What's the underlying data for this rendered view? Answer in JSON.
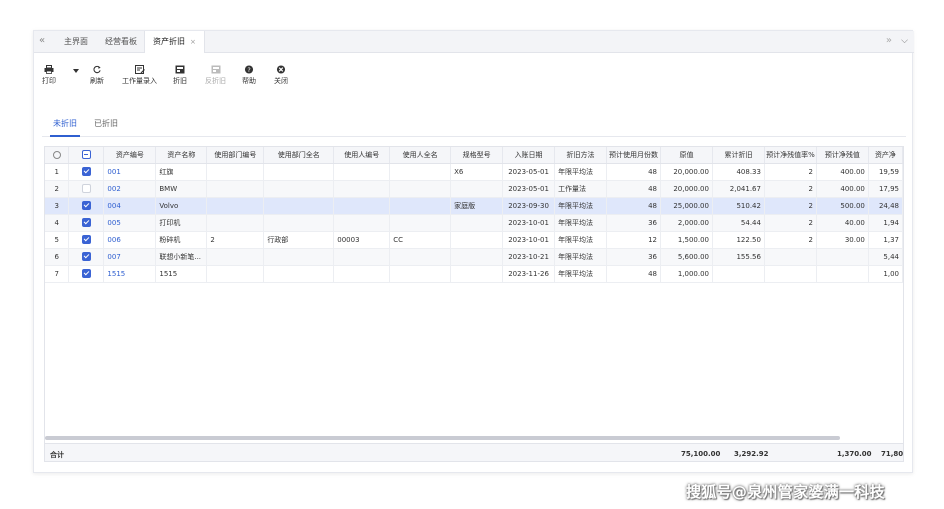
{
  "tabbar": {
    "tabs": [
      {
        "label": "主界面"
      },
      {
        "label": "经营看板"
      },
      {
        "label": "资产折旧",
        "close": "×"
      }
    ]
  },
  "toolbar": {
    "print": "打印",
    "refresh": "刷新",
    "workload": "工作量录入",
    "depreciate": "折旧",
    "reverse": "反折旧",
    "help": "帮助",
    "close": "关闭"
  },
  "subtabs": [
    "未折旧",
    "已折旧"
  ],
  "grid": {
    "headers": [
      "资产编号",
      "资产名称",
      "使用部门编号",
      "使用部门全名",
      "使用人编号",
      "使用人全名",
      "规格型号",
      "入账日期",
      "折旧方法",
      "预计使用月份数",
      "原值",
      "累计折旧",
      "预计净残值率%",
      "预计净残值",
      "资产净"
    ],
    "rows": [
      {
        "no": "1",
        "code": "001",
        "name": "红旗",
        "dept_code": "",
        "dept_name": "",
        "user_code": "",
        "user_name": "",
        "spec": "X6",
        "date": "2023-05-01",
        "method": "年限平均法",
        "months": "48",
        "orig": "20,000.00",
        "accum": "408.33",
        "rate": "2",
        "residual": "400.00",
        "net": "19,59"
      },
      {
        "no": "2",
        "code": "002",
        "name": "BMW",
        "dept_code": "",
        "dept_name": "",
        "user_code": "",
        "user_name": "",
        "spec": "",
        "date": "2023-05-01",
        "method": "工作量法",
        "months": "48",
        "orig": "20,000.00",
        "accum": "2,041.67",
        "rate": "2",
        "residual": "400.00",
        "net": "17,95"
      },
      {
        "no": "3",
        "code": "004",
        "name": "Volvo",
        "dept_code": "",
        "dept_name": "",
        "user_code": "",
        "user_name": "",
        "spec": "家庭版",
        "date": "2023-09-30",
        "method": "年限平均法",
        "months": "48",
        "orig": "25,000.00",
        "accum": "510.42",
        "rate": "2",
        "residual": "500.00",
        "net": "24,48"
      },
      {
        "no": "4",
        "code": "005",
        "name": "打印机",
        "dept_code": "",
        "dept_name": "",
        "user_code": "",
        "user_name": "",
        "spec": "",
        "date": "2023-10-01",
        "method": "年限平均法",
        "months": "36",
        "orig": "2,000.00",
        "accum": "54.44",
        "rate": "2",
        "residual": "40.00",
        "net": "1,94"
      },
      {
        "no": "5",
        "code": "006",
        "name": "粉碎机",
        "dept_code": "2",
        "dept_name": "行政部",
        "user_code": "00003",
        "user_name": "CC",
        "spec": "",
        "date": "2023-10-01",
        "method": "年限平均法",
        "months": "12",
        "orig": "1,500.00",
        "accum": "122.50",
        "rate": "2",
        "residual": "30.00",
        "net": "1,37"
      },
      {
        "no": "6",
        "code": "007",
        "name": "联想小新笔...",
        "dept_code": "",
        "dept_name": "",
        "user_code": "",
        "user_name": "",
        "spec": "",
        "date": "2023-10-21",
        "method": "年限平均法",
        "months": "36",
        "orig": "5,600.00",
        "accum": "155.56",
        "rate": "",
        "residual": "",
        "net": "5,44"
      },
      {
        "no": "7",
        "code": "1515",
        "name": "1515",
        "dept_code": "",
        "dept_name": "",
        "user_code": "",
        "user_name": "",
        "spec": "",
        "date": "2023-11-26",
        "method": "年限平均法",
        "months": "48",
        "orig": "1,000.00",
        "accum": "",
        "rate": "",
        "residual": "",
        "net": "1,00"
      }
    ],
    "totals": {
      "label": "合计",
      "orig": "75,100.00",
      "accum": "3,292.92",
      "residual": "1,370.00",
      "net": "71,80"
    }
  },
  "watermark": "搜狐号@泉州管家婆满一科技"
}
